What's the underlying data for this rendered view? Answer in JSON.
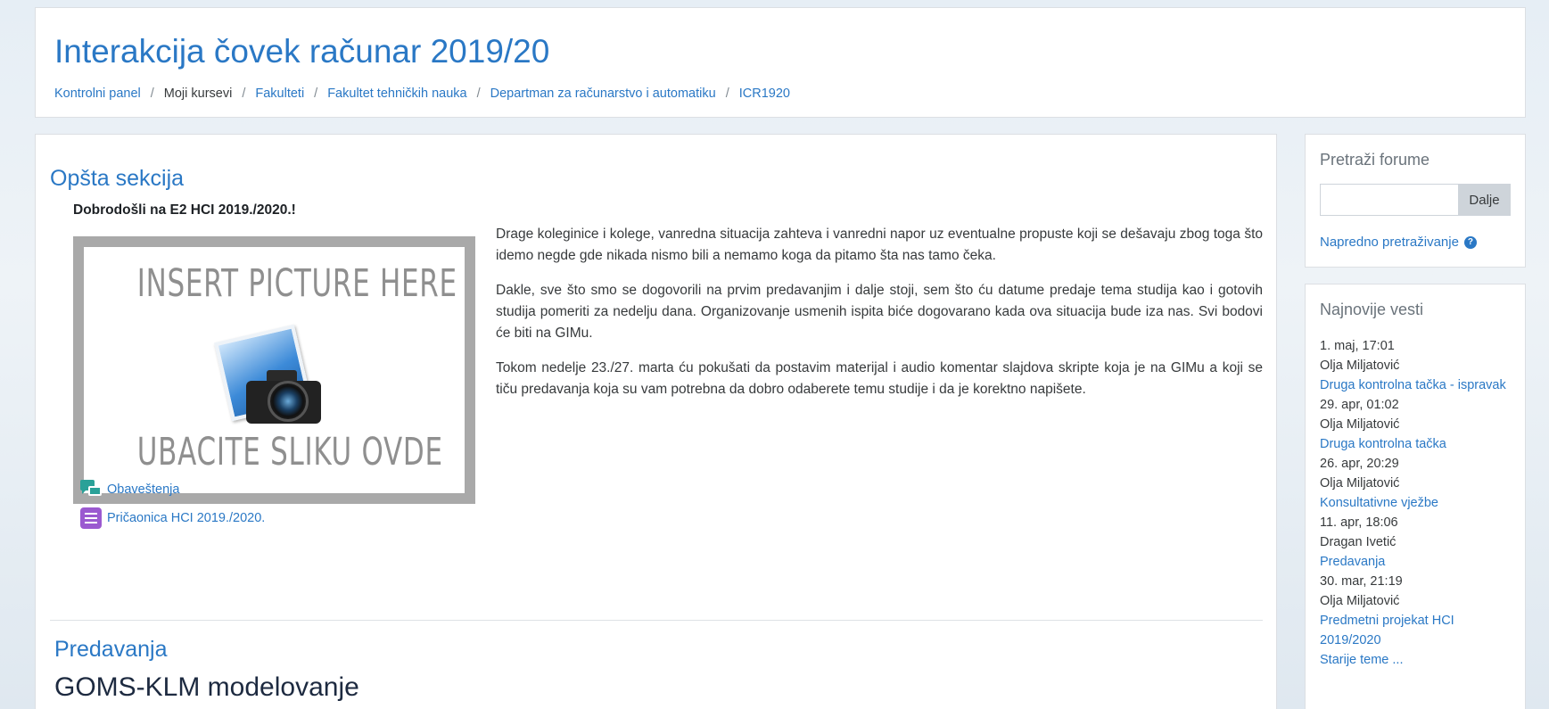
{
  "header": {
    "title": "Interakcija čovek računar 2019/20",
    "breadcrumb": [
      {
        "label": "Kontrolni panel"
      },
      {
        "label": "Moji kursevi"
      },
      {
        "label": "Fakulteti"
      },
      {
        "label": "Fakultet tehničkih nauka"
      },
      {
        "label": "Departman za računarstvo i automatiku"
      },
      {
        "label": "ICR1920"
      }
    ],
    "separator": "/"
  },
  "section": {
    "title": "Opšta sekcija",
    "welcome": "Dobrodošli na E2 HCI 2019./2020.!",
    "image": {
      "top_text": "INSERT PICTURE HERE",
      "bottom_text": "UBACITE SLIKU OVDE"
    },
    "paragraphs": [
      "Drage koleginice i kolege, vanredna situacija zahteva i vanredni napor uz eventualne propuste koji se dešavaju zbog toga što idemo negde gde nikada nismo bili a nemamo koga da pitamo šta nas tamo čeka.",
      "Dakle, sve što smo se dogovorili na prvim predavanjim i dalje stoji, sem što ću datume predaje tema studija kao i gotovih studija pomeriti za nedelju dana. Organizovanje usmenih ispita biće dogovarano kada ova situacija bude iza nas. Svi bodovi će biti na GIMu.",
      "Tokom nedelje 23./27. marta ću pokušati da postavim materijal i audio komentar slajdova skripte koja je na GIMu a koji se tiču predavanja koja su vam potrebna da dobro odaberete temu studije i da je korektno napišete."
    ],
    "activities": [
      {
        "label": "Obaveštenja",
        "icon": "forum-icon"
      },
      {
        "label": "Pričaonica HCI 2019./2020.",
        "icon": "chat-icon"
      }
    ]
  },
  "next_section": {
    "title": "Predavanja",
    "topic": "GOMS-KLM modelovanje"
  },
  "search_block": {
    "title": "Pretraži forume",
    "input_value": "",
    "button": "Dalje",
    "advanced_link": "Napredno pretraživanje"
  },
  "news_block": {
    "title": "Najnovije vesti",
    "items": [
      {
        "date": "1. maj, 17:01",
        "author": "Olja Miljatović",
        "title": "Druga kontrolna tačka - ispravak"
      },
      {
        "date": "29. apr, 01:02",
        "author": "Olja Miljatović",
        "title": "Druga kontrolna tačka"
      },
      {
        "date": "26. apr, 20:29",
        "author": "Olja Miljatović",
        "title": "Konsultativne vježbe"
      },
      {
        "date": "11. apr, 18:06",
        "author": "Dragan Ivetić",
        "title": "Predavanja"
      },
      {
        "date": "30. mar, 21:19",
        "author": "Olja Miljatović",
        "title": "Predmetni projekat HCI 2019/2020"
      }
    ],
    "more_link": "Starije teme ..."
  },
  "colors": {
    "link": "#2a78c5",
    "forum_icon": "#2aa198",
    "chat_icon": "#9b59d0"
  }
}
